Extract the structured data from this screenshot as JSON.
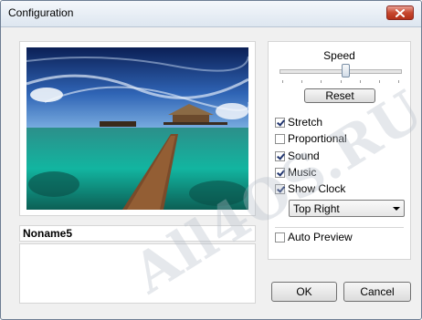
{
  "window": {
    "title": "Configuration"
  },
  "preview": {
    "name": "Noname5",
    "description": ""
  },
  "options": {
    "speed_label": "Speed",
    "speed_level": 0.55,
    "reset_label": "Reset",
    "checkboxes": [
      {
        "label": "Stretch",
        "checked": true
      },
      {
        "label": "Proportional",
        "checked": false
      },
      {
        "label": "Sound",
        "checked": true
      },
      {
        "label": "Music",
        "checked": true
      },
      {
        "label": "Show Clock",
        "checked": true
      }
    ],
    "clock_position": "Top Right",
    "auto_preview": {
      "label": "Auto Preview",
      "checked": false
    }
  },
  "buttons": {
    "ok": "OK",
    "cancel": "Cancel"
  },
  "watermark": "All4OS.RU"
}
